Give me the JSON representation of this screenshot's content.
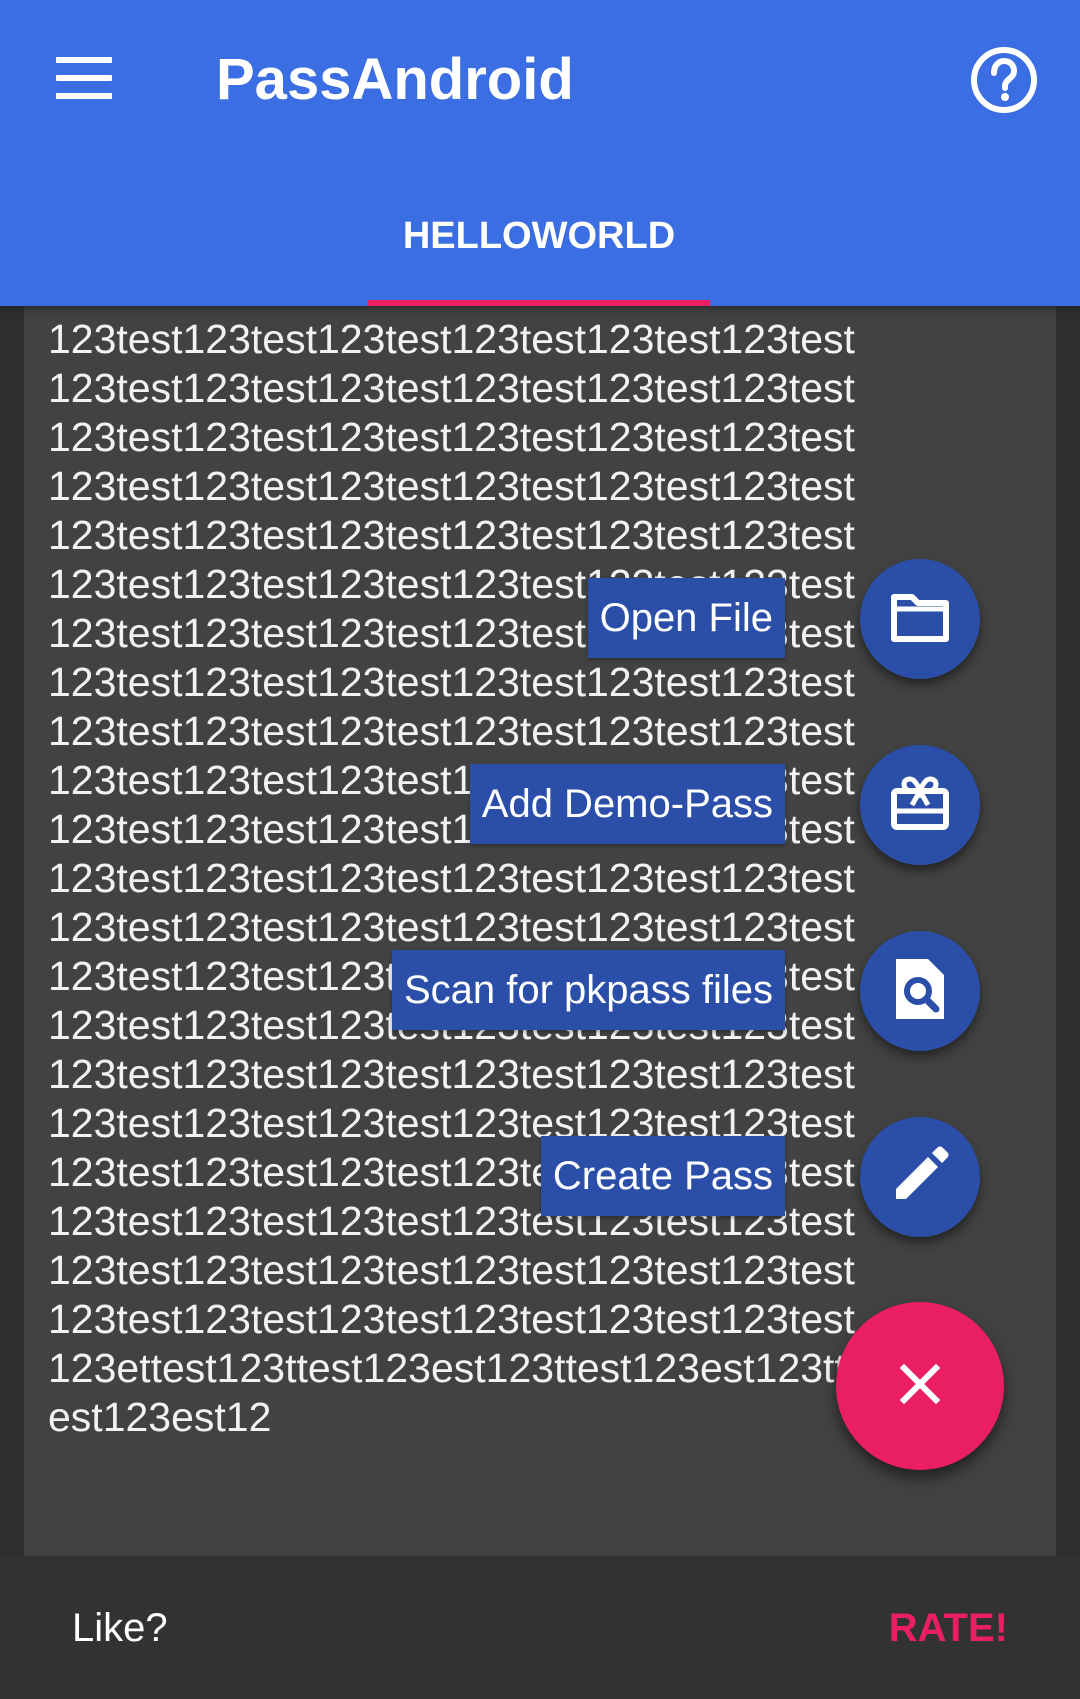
{
  "app": {
    "title": "PassAndroid"
  },
  "tabs": [
    {
      "label": "HELLOWORLD",
      "selected": true
    }
  ],
  "content": {
    "text": "123test123test123test123test123test123test123test123test123test123test123test123test123test123test123test123test123test123test123test123test123test123test123test123test123test123test123test123test123test123test123test123test123test123test123test123test123test123test123test123test123test123test123test123test123test123test123test123test123test123test123test123test123test123test123test123test123test123test123test123test123test123test123test123test123test123test123test123test123test123test123test123test123test123test123test123test123test123test123test123test123test123test123test123test123test123test123test123test123test123test123test123test123test123test123test123test123test123test123test123test123test123test123test123test123test123test123test123test123test123test123test123test123test123test123test123test123test123test123test123test123test123test123test123test123test123test123test123test123test123test123test123test123ettest123ttest123est123ttest123est123ttest123est12"
  },
  "fab_menu": {
    "items": [
      {
        "label": "Open File",
        "icon": "folder-icon"
      },
      {
        "label": "Add Demo-Pass",
        "icon": "card-giftcard-icon"
      },
      {
        "label": "Scan for pkpass files",
        "icon": "find-in-page-icon"
      },
      {
        "label": "Create Pass",
        "icon": "edit-icon"
      }
    ],
    "close_icon": "close-icon"
  },
  "snackbar": {
    "text": "Like?",
    "action": "RATE!"
  },
  "colors": {
    "primary": "#3b6de3",
    "accent": "#e91e63",
    "mini_fab": "#2b4fa8"
  }
}
